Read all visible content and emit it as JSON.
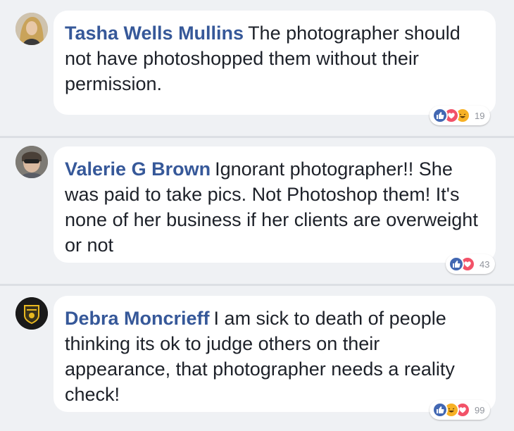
{
  "comments": [
    {
      "author": "Tasha Wells Mullins",
      "text": "The photographer should not have photoshopped them without their permission.",
      "reactions": [
        "like-icon",
        "love-icon",
        "haha-icon"
      ],
      "count": "19"
    },
    {
      "author": "Valerie G Brown",
      "text": "Ignorant photographer!! She was paid to take pics. Not Photoshop them! It's none of her business if her clients are overweight or not",
      "reactions": [
        "like-icon",
        "love-icon"
      ],
      "count": "43"
    },
    {
      "author": "Debra Moncrieff",
      "text": "I am sick to death of people thinking its ok to judge others on their appearance, that photographer needs a reality check!",
      "reactions": [
        "like-icon",
        "haha-icon",
        "love-icon"
      ],
      "count": "99"
    }
  ],
  "colors": {
    "author": "#365899",
    "like": "#4267b2",
    "love": "#f25268",
    "haha": "#f7b125"
  }
}
